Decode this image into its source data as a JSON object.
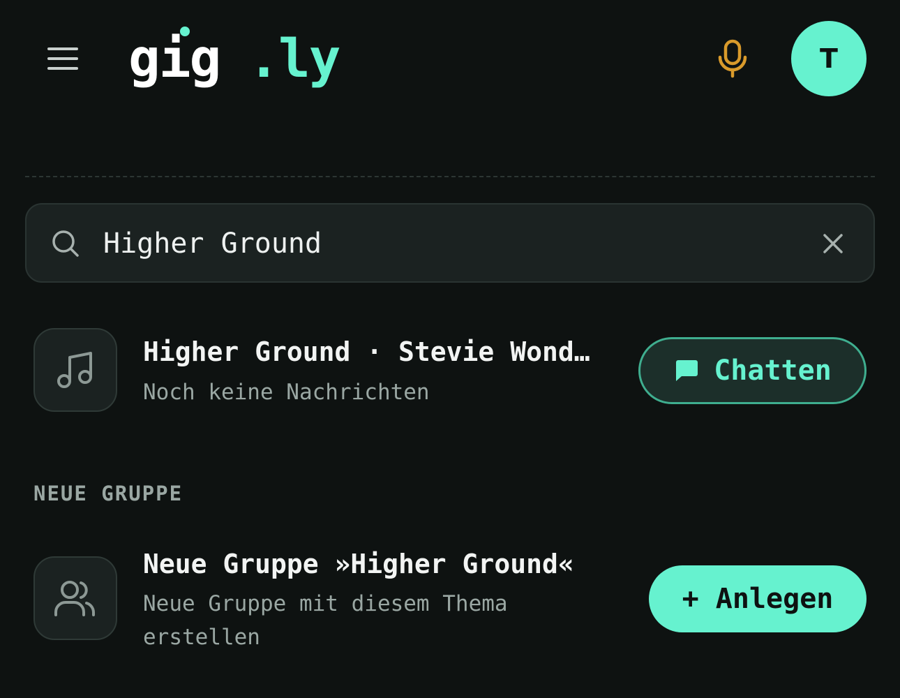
{
  "header": {
    "logo_part1": "gig",
    "logo_part2": ".ly",
    "avatar_initial": "T",
    "icons": {
      "menu": "menu-icon",
      "mic": "microphone-icon"
    }
  },
  "search": {
    "value": "Higher Ground",
    "icons": {
      "search": "search-icon",
      "clear": "close-icon"
    }
  },
  "results": [
    {
      "icon": "music-note-icon",
      "title": "Higher Ground · Stevie Wond…",
      "subtitle": "Noch keine Nachrichten",
      "action_label": "Chatten",
      "action_icon": "chat-bubble-icon"
    }
  ],
  "new_group": {
    "section_label": "NEUE GRUPPE",
    "icon": "group-icon",
    "title": "Neue Gruppe »Higher Ground«",
    "subtitle_line1": "Neue Gruppe mit diesem Thema",
    "subtitle_line2": "erstellen",
    "action_label": "+ Anlegen"
  },
  "colors": {
    "background": "#0e1211",
    "accent": "#66f2cf",
    "mic": "#d99a2b",
    "muted": "#9aa7a3"
  }
}
